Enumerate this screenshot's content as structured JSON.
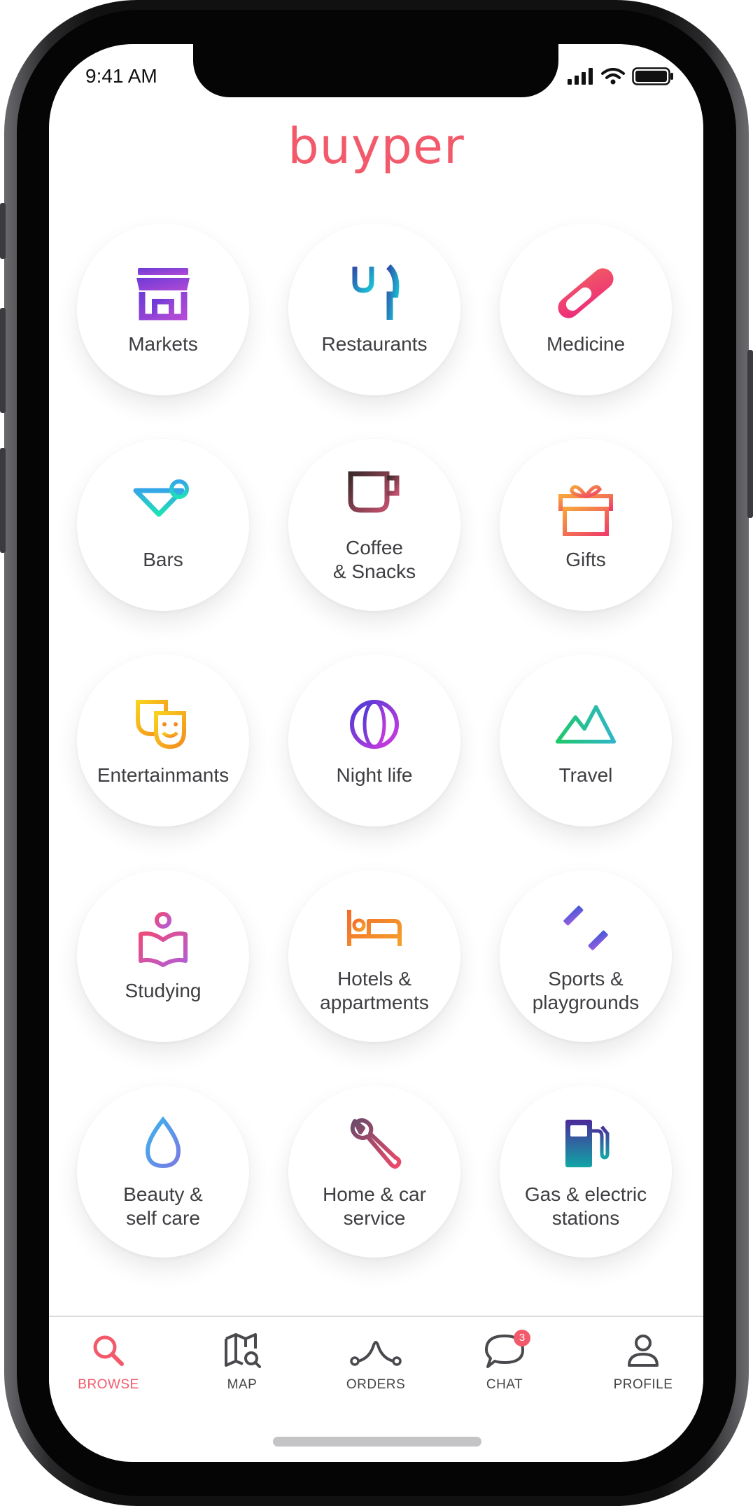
{
  "status": {
    "time": "9:41 AM"
  },
  "brand": {
    "name": "buyper",
    "color": "#f25a6b"
  },
  "categories": [
    {
      "label": "Markets",
      "icon": "storefront-icon"
    },
    {
      "label": "Restaurants",
      "icon": "fork-knife-icon"
    },
    {
      "label": "Medicine",
      "icon": "pill-icon"
    },
    {
      "label": "Bars",
      "icon": "cocktail-icon"
    },
    {
      "label": "Coffee\n& Snacks",
      "icon": "coffee-cup-icon"
    },
    {
      "label": "Gifts",
      "icon": "gift-icon"
    },
    {
      "label": "Entertainmants",
      "icon": "theater-masks-icon"
    },
    {
      "label": "Night life",
      "icon": "globe-icon"
    },
    {
      "label": "Travel",
      "icon": "mountains-icon"
    },
    {
      "label": "Studying",
      "icon": "reader-book-icon"
    },
    {
      "label": "Hotels &\nappartments",
      "icon": "bed-icon"
    },
    {
      "label": "Sports &\nplaygrounds",
      "icon": "dumbbell-icon"
    },
    {
      "label": "Beauty &\nself care",
      "icon": "droplet-icon"
    },
    {
      "label": "Home & car\nservice",
      "icon": "wrench-icon"
    },
    {
      "label": "Gas & electric\nstations",
      "icon": "fuel-pump-icon"
    }
  ],
  "tabbar": {
    "tabs": [
      {
        "label": "BROWSE",
        "icon": "search-icon",
        "active": true
      },
      {
        "label": "MAP",
        "icon": "map-search-icon",
        "active": false
      },
      {
        "label": "ORDERS",
        "icon": "route-icon",
        "active": false
      },
      {
        "label": "CHAT",
        "icon": "chat-bubble-icon",
        "active": false,
        "badge": "3"
      },
      {
        "label": "PROFILE",
        "icon": "user-icon",
        "active": false
      }
    ]
  },
  "colors": {
    "accent": "#f25a6b",
    "text": "#3e3e42",
    "tab_inactive": "#444444"
  }
}
